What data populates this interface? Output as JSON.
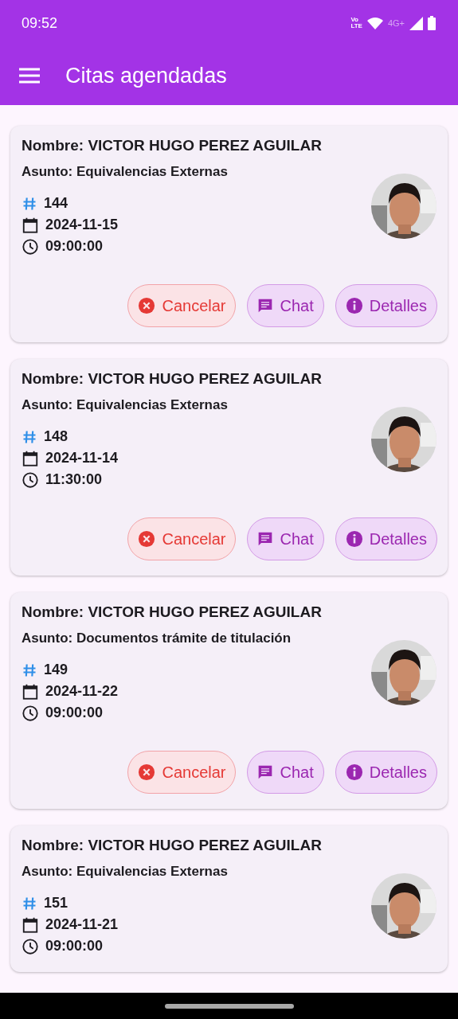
{
  "status_bar": {
    "time": "09:52",
    "volte_top": "Vo",
    "volte_bottom": "LTE",
    "network": "4G+"
  },
  "app_bar": {
    "title": "Citas agendadas"
  },
  "appointments": [
    {
      "name": "Nombre: VICTOR HUGO PEREZ AGUILAR",
      "subject": "Asunto: Equivalencias Externas",
      "number": "144",
      "date": "2024-11-15",
      "time": "09:00:00",
      "avatar": {
        "kind": "picture"
      },
      "buttons": [
        {
          "kind": "cancel",
          "label": "Cancelar"
        },
        {
          "kind": "chat",
          "label": "Chat"
        },
        {
          "kind": "details",
          "label": "Detalles"
        }
      ]
    },
    {
      "name": "Nombre: VICTOR HUGO PEREZ AGUILAR",
      "subject": "Asunto: Equivalencias Externas",
      "number": "148",
      "date": "2024-11-14",
      "time": "11:30:00",
      "avatar": {
        "kind": "picture"
      },
      "buttons": [
        {
          "kind": "cancel",
          "label": "Cancelar"
        },
        {
          "kind": "chat",
          "label": "Chat"
        },
        {
          "kind": "details",
          "label": "Detalles"
        }
      ]
    },
    {
      "name": "Nombre: VICTOR HUGO PEREZ AGUILAR",
      "subject": "Asunto: Documentos trámite de titulación",
      "number": "149",
      "date": "2024-11-22",
      "time": "09:00:00",
      "avatar": {
        "kind": "picture"
      },
      "buttons": [
        {
          "kind": "cancel",
          "label": "Cancelar"
        },
        {
          "kind": "chat",
          "label": "Chat"
        },
        {
          "kind": "details",
          "label": "Detalles"
        }
      ]
    },
    {
      "name": "Nombre: VICTOR HUGO PEREZ AGUILAR",
      "subject": "Asunto: Equivalencias Externas",
      "number": "151",
      "date": "2024-11-21",
      "time": "09:00:00",
      "avatar": {
        "kind": "picture"
      }
    }
  ]
}
